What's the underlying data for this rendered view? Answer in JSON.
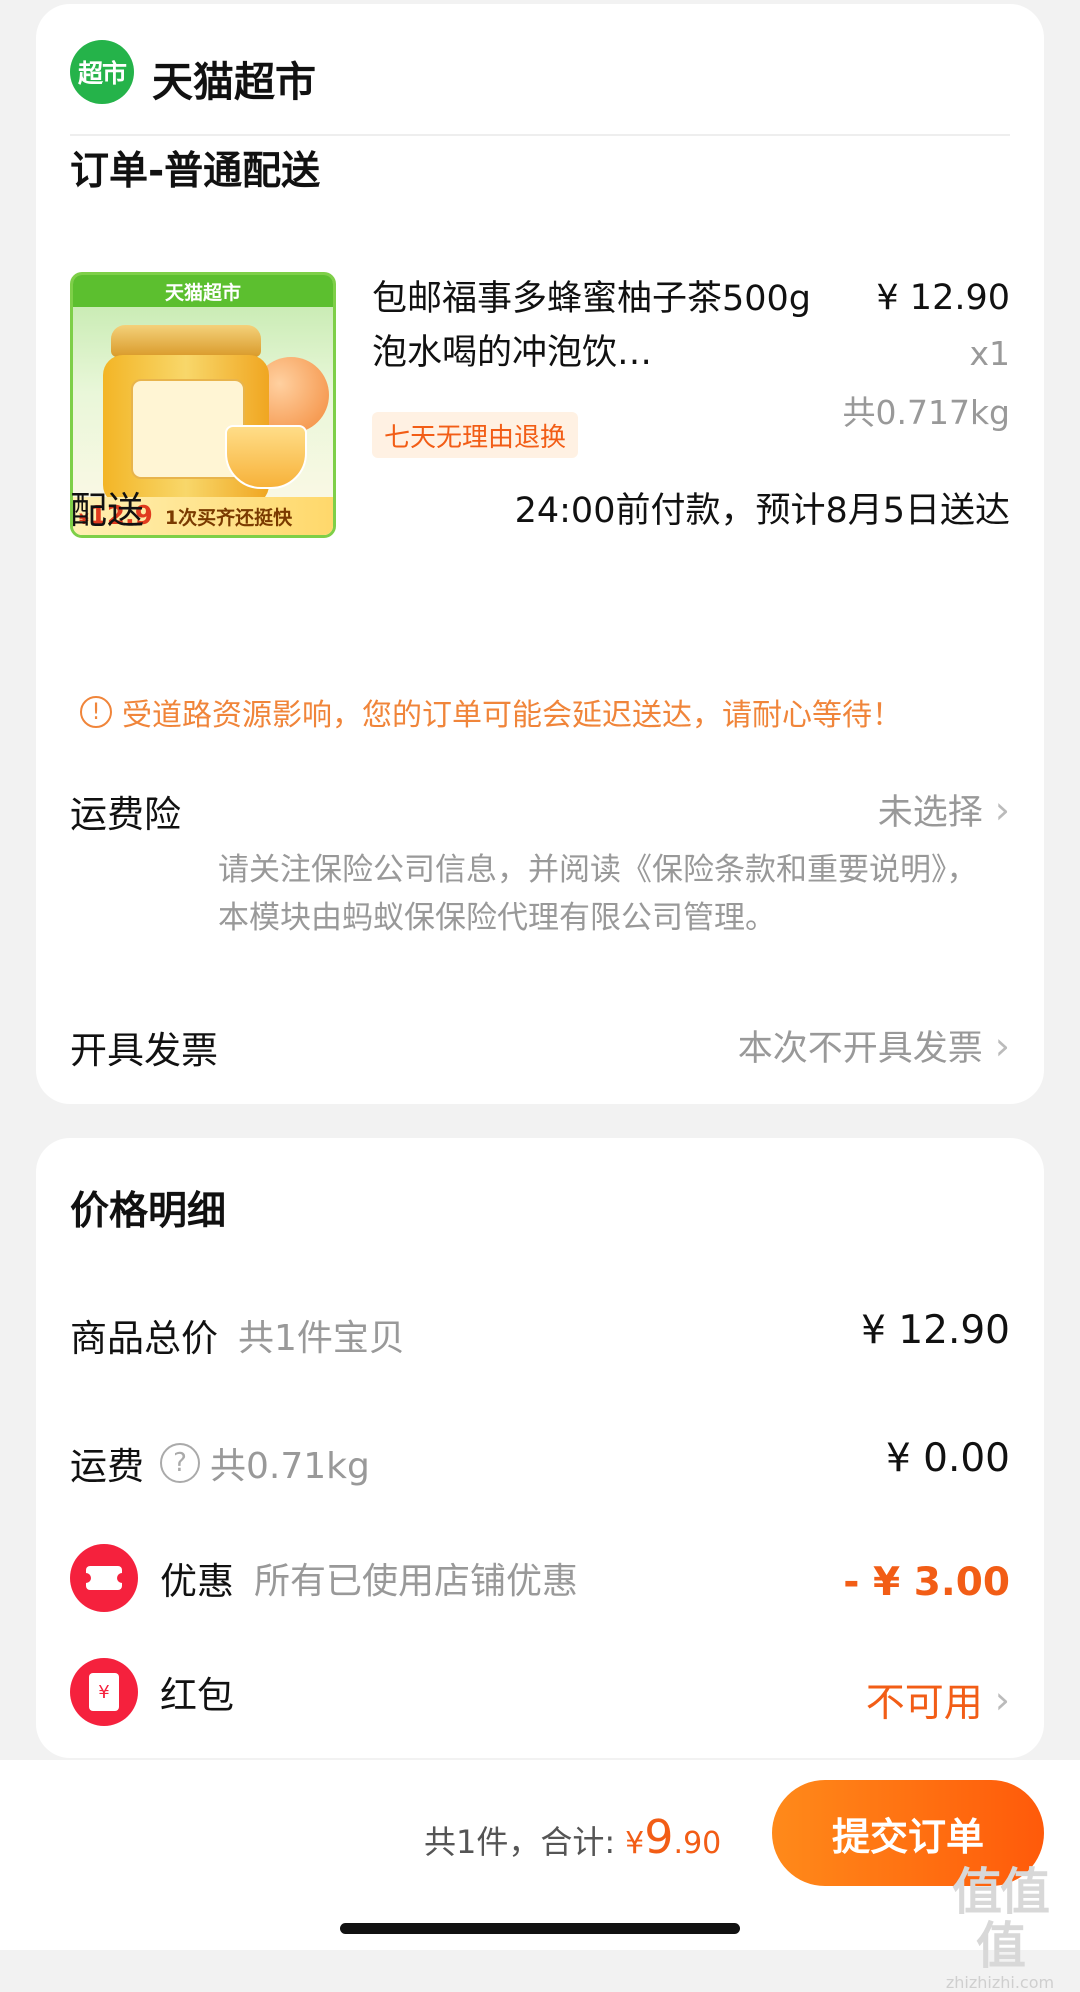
{
  "store": {
    "logo_text": "超市",
    "name": "天猫超市"
  },
  "order": {
    "section_title": "订单-普通配送",
    "product": {
      "image": {
        "top_banner": "天猫超市",
        "price_currency": "¥",
        "price": "12.9",
        "slogan": "1次买齐还挺快"
      },
      "title": "包邮福事多蜂蜜柚子茶500g泡水喝的冲泡饮…",
      "price": "¥ 12.90",
      "quantity": "x1",
      "weight": "共0.717kg",
      "badge": "七天无理由退换"
    },
    "delivery": {
      "label": "配送",
      "value": "24:00前付款，预计8月5日送达"
    },
    "warning": {
      "icon": "!",
      "text": "受道路资源影响，您的订单可能会延迟送达，请耐心等待！"
    },
    "shipping_insurance": {
      "label": "运费险",
      "value": "未选择",
      "description": "请关注保险公司信息，并阅读《保险条款和重要说明》，本模块由蚂蚁保保险代理有限公司管理。"
    },
    "invoice": {
      "label": "开具发票",
      "value": "本次不开具发票"
    }
  },
  "price_detail": {
    "title": "价格明细",
    "goods_total": {
      "label": "商品总价",
      "sub": "共1件宝贝",
      "value": "¥ 12.90"
    },
    "shipping_fee": {
      "label": "运费",
      "help_icon": "?",
      "sub": "共0.71kg",
      "value": "¥ 0.00"
    },
    "discount": {
      "label": "优惠",
      "sub": "所有已使用店铺优惠",
      "value": "- ¥ 3.00"
    },
    "red_packet": {
      "label": "红包",
      "icon_text": "¥",
      "value": "不可用"
    }
  },
  "bottom_bar": {
    "count_text": "共1件，",
    "total_label": "合计:",
    "total_currency": "¥",
    "total_integer": "9",
    "total_decimal": ".90",
    "submit_label": "提交订单"
  },
  "watermark": {
    "main": "值值值",
    "sub": "zhizhizhi.com"
  },
  "colors": {
    "accent": "#f25d16",
    "brand_green": "#25b34a",
    "red_icon": "#f5213d"
  },
  "icons": [
    "chevron-right-icon",
    "warning-icon",
    "help-icon",
    "coupon-icon",
    "red-packet-icon"
  ]
}
